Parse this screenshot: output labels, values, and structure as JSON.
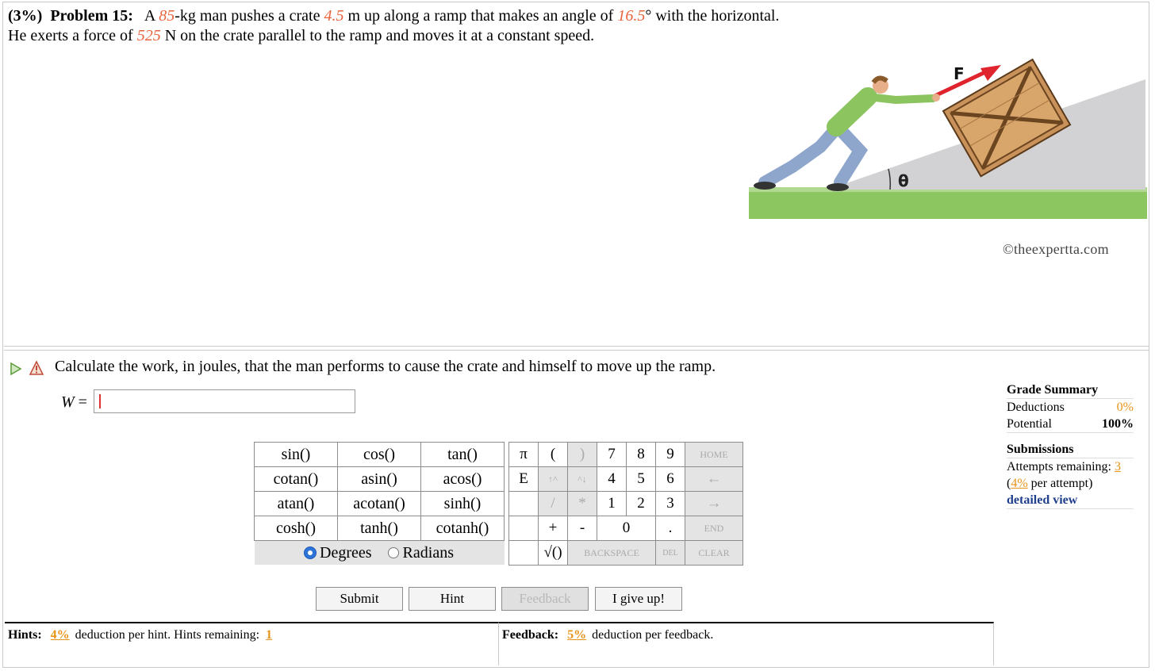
{
  "problem": {
    "weight": "(3%)",
    "label": "Problem 15:",
    "t1": "A ",
    "mass": "85",
    "t2": "-kg man pushes a crate ",
    "dist": "4.5",
    "t3": " m up along a ramp that makes an angle of ",
    "angle": "16.5",
    "t4": "° with the horizontal. He exerts a force of ",
    "force": "525",
    "t5": " N on the crate parallel to the ramp and moves it at a constant speed."
  },
  "figure": {
    "force_label": "F",
    "angle_label": "θ",
    "credit": "©theexpertta.com"
  },
  "question": {
    "text": "Calculate the work, in joules, that the man performs to cause the crate and himself to move up the ramp.",
    "var": "W",
    "eq": " = ",
    "value": ""
  },
  "functions": [
    [
      "sin()",
      "cos()",
      "tan()"
    ],
    [
      "cotan()",
      "asin()",
      "acos()"
    ],
    [
      "atan()",
      "acotan()",
      "sinh()"
    ],
    [
      "cosh()",
      "tanh()",
      "cotanh()"
    ]
  ],
  "angle_mode": {
    "degrees": "Degrees",
    "radians": "Radians",
    "selected": "Degrees"
  },
  "keypad": {
    "pi": "π",
    "e": "E",
    "lparen": "(",
    "rparen": ")",
    "up": "↑^",
    "down": "^↓",
    "slash": "/",
    "star": "*",
    "plus": "+",
    "minus": "-",
    "sqrt": "√()",
    "dot": ".",
    "d7": "7",
    "d8": "8",
    "d9": "9",
    "d4": "4",
    "d5": "5",
    "d6": "6",
    "d1": "1",
    "d2": "2",
    "d3": "3",
    "d0": "0",
    "home": "HOME",
    "left": "←",
    "right": "→",
    "end": "END",
    "backspace": "BACKSPACE",
    "del": "DEL",
    "clear": "CLEAR"
  },
  "buttons": {
    "submit": "Submit",
    "hint": "Hint",
    "feedback": "Feedback",
    "giveup": "I give up!"
  },
  "grade": {
    "title": "Grade Summary",
    "deductions_label": "Deductions",
    "deductions": "0%",
    "potential_label": "Potential",
    "potential": "100%",
    "submissions_title": "Submissions",
    "attempts_label": "Attempts remaining: ",
    "attempts": "3",
    "per_attempt_open": "(",
    "per_attempt": "4%",
    "per_attempt_rest": " per attempt)",
    "detailed": "detailed view"
  },
  "hints": {
    "label": "Hints:",
    "pct": "4%",
    "text": " deduction per hint. Hints remaining: ",
    "remaining": "1"
  },
  "feedback": {
    "label": "Feedback:",
    "pct": "5%",
    "text": " deduction per feedback."
  },
  "colors": {
    "highlight": "#e8643c",
    "accent": "#e8941a",
    "link": "#1f3f8c",
    "radio": "#2e73d6"
  }
}
